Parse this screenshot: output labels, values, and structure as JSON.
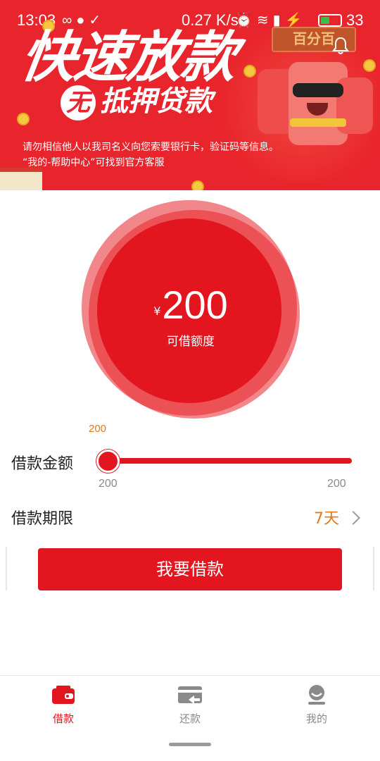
{
  "status_bar": {
    "time": "13:03",
    "speed": "0.27 K/s",
    "battery": "33",
    "icons_left": [
      "infinity-icon",
      "chat-icon",
      "check-icon"
    ],
    "icons_right": [
      "alarm-icon",
      "wifi-icon",
      "signal-icon",
      "charging-icon",
      "battery-icon"
    ]
  },
  "banner": {
    "headline": "快速放款",
    "subline_mark": "无",
    "subline": "抵押贷款",
    "brand": "百分百",
    "notice_line1": "请勿相信他人以我司名义向您索要银行卡，验证码等信息。",
    "notice_line2": "“我的-帮助中心”可找到官方客服"
  },
  "amount": {
    "currency": "¥",
    "value": "200",
    "label": "可借额度"
  },
  "slider": {
    "current": "200",
    "label": "借款金额",
    "min": "200",
    "max": "200",
    "fraction": 0
  },
  "term": {
    "label": "借款期限",
    "value": "7天"
  },
  "submit": {
    "label": "我要借款"
  },
  "nav": {
    "items": [
      {
        "label": "借款",
        "icon": "wallet-icon",
        "active": true
      },
      {
        "label": "还款",
        "icon": "card-return-icon",
        "active": false
      },
      {
        "label": "我的",
        "icon": "profile-icon",
        "active": false
      }
    ]
  },
  "colors": {
    "primary": "#e3151f",
    "banner": "#e8252c",
    "accent_orange": "#e17a17",
    "muted": "#8a8a8a"
  }
}
